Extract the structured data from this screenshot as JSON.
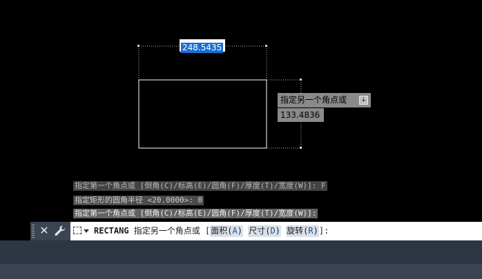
{
  "canvas": {
    "background": "#000000",
    "dynamic_length_value": "248.5435",
    "tooltip_prompt": "指定另一个角点或",
    "tooltip_icon": "down-arrow-icon",
    "tooltip_value": "133.4836"
  },
  "history": [
    "指定第一个角点或 [倒角(C)/标高(E)/圆角(F)/厚度(T)/宽度(W)]: F",
    "指定矩形的圆角半径 <20.0000>: 0",
    "指定第一个角点或 [倒角(C)/标高(E)/圆角(F)/厚度(T)/宽度(W)]:"
  ],
  "command_line": {
    "close_icon": "close-icon",
    "customize_icon": "wrench-icon",
    "recent_commands_icon": "recent-commands-icon",
    "command_name": "RECTANG",
    "prompt": " 指定另一个角点或 [",
    "options": [
      {
        "label": "面积(",
        "key": "A",
        "close": ")"
      },
      {
        "label": "尺寸(",
        "key": "D",
        "close": ")"
      },
      {
        "label": "旋转(",
        "key": "R",
        "close": ")"
      }
    ],
    "suffix": "]:"
  },
  "colors": {
    "command_option_bg": "#dbe1ea",
    "command_option_key": "#1d4fa5",
    "selection_blue": "#1a6fd1",
    "ui_panel": "#3b4453"
  }
}
